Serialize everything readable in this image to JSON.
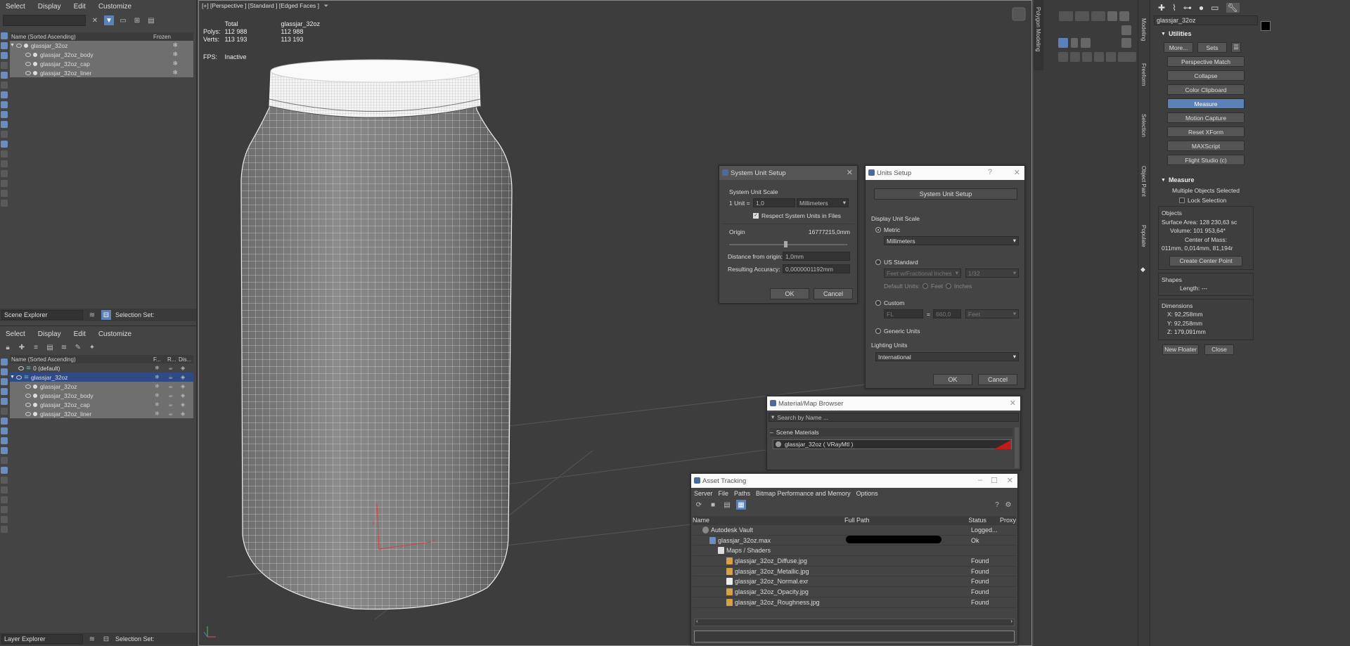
{
  "scene_explorer": {
    "menu": [
      "Select",
      "Display",
      "Edit",
      "Customize"
    ],
    "header_name": "Name (Sorted Ascending)",
    "header_frozen": "Frozen",
    "items": [
      "glassjar_32oz",
      "glassjar_32oz_body",
      "glassjar_32oz_cap",
      "glassjar_32oz_liner"
    ],
    "bottom_label": "Scene Explorer",
    "selection_set": "Selection Set:"
  },
  "layer_explorer": {
    "menu": [
      "Select",
      "Display",
      "Edit",
      "Customize"
    ],
    "header_name": "Name (Sorted Ascending)",
    "header_cols": [
      "F...",
      "R...",
      "Dis..."
    ],
    "items": [
      "0 (default)",
      "glassjar_32oz",
      "glassjar_32oz",
      "glassjar_32oz_body",
      "glassjar_32oz_cap",
      "glassjar_32oz_liner"
    ],
    "bottom_label": "Layer Explorer",
    "selection_set": "Selection Set:"
  },
  "viewport": {
    "label": "[+] [Perspective ] [Standard ] [Edged Faces ]",
    "stats": {
      "col_total": "Total",
      "col_object": "glassjar_32oz",
      "polys_label": "Polys:",
      "polys_total": "112 988",
      "polys_obj": "112 988",
      "verts_label": "Verts:",
      "verts_total": "113 193",
      "verts_obj": "113 193",
      "fps_label": "FPS:",
      "fps_value": "Inactive"
    }
  },
  "system_unit_setup": {
    "title": "System Unit Setup",
    "group": "System Unit Scale",
    "unit_label": "1 Unit =",
    "unit_value": "1,0",
    "unit_type": "Millimeters",
    "respect_label": "Respect System Units in Files",
    "origin_label": "Origin",
    "origin_value": "16777215,0mm",
    "distance_label": "Distance from origin:",
    "distance_value": "1,0mm",
    "accuracy_label": "Resulting Accuracy:",
    "accuracy_value": "0,0000001192mm",
    "ok": "OK",
    "cancel": "Cancel"
  },
  "units_setup": {
    "title": "Units Setup",
    "help": "?",
    "system_button": "System Unit Setup",
    "display_scale": "Display Unit Scale",
    "metric": "Metric",
    "metric_value": "Millimeters",
    "us_standard": "US Standard",
    "us_value": "Feet w/Fractional Inches",
    "us_fraction": "1/32",
    "default_units": "Default Units:",
    "feet": "Feet",
    "inches": "Inches",
    "custom": "Custom",
    "custom_value": "FL",
    "custom_equals": "=",
    "custom_amount": "660,0",
    "custom_unit": "Feet",
    "generic": "Generic Units",
    "lighting": "Lighting Units",
    "lighting_value": "International",
    "ok": "OK",
    "cancel": "Cancel"
  },
  "material_browser": {
    "title": "Material/Map Browser",
    "search": "Search by Name ...",
    "section": "Scene Materials",
    "item": "glassjar_32oz  ( VRayMtl )"
  },
  "asset_tracking": {
    "title": "Asset Tracking",
    "menu": [
      "Server",
      "File",
      "Paths",
      "Bitmap Performance and Memory",
      "Options"
    ],
    "columns": [
      "Name",
      "Full Path",
      "Status",
      "Proxy"
    ],
    "rows": [
      {
        "name": "Autodesk Vault",
        "status": "Logged..."
      },
      {
        "name": "glassjar_32oz.max",
        "status": "Ok"
      },
      {
        "name": "Maps / Shaders",
        "status": ""
      },
      {
        "name": "glassjar_32oz_Diffuse.jpg",
        "status": "Found"
      },
      {
        "name": "glassjar_32oz_Metallic.jpg",
        "status": "Found"
      },
      {
        "name": "glassjar_32oz_Normal.exr",
        "status": "Found"
      },
      {
        "name": "glassjar_32oz_Opacity.jpg",
        "status": "Found"
      },
      {
        "name": "glassjar_32oz_Roughness.jpg",
        "status": "Found"
      }
    ]
  },
  "ribbon": {
    "title": "Polygon Modeling",
    "tabs": [
      "Modeling",
      "Freeform",
      "Selection",
      "Object Paint",
      "Populate"
    ]
  },
  "command_panel": {
    "object_name": "glassjar_32oz",
    "utilities_title": "Utilities",
    "more": "More...",
    "sets": "Sets",
    "buttons": [
      "Perspective Match",
      "Collapse",
      "Color Clipboard",
      "Measure",
      "Motion Capture",
      "Reset XForm",
      "MAXScript",
      "Flight Studio (c)"
    ],
    "measure_title": "Measure",
    "multiple": "Multiple Objects Selected",
    "lock_selection": "Lock Selection",
    "objects_group": "Objects",
    "surface_area": "Surface Area:  128 230,63 sc",
    "volume": "Volume:  101 953,64*",
    "center_mass": "Center of Mass:",
    "center_mass_value": "011mm, 0,014mm, 81,194r",
    "create_center": "Create Center Point",
    "shapes_group": "Shapes",
    "length": "Length:  ---",
    "dimensions_group": "Dimensions",
    "dim_x": "X:   92,258mm",
    "dim_y": "Y:   92,258mm",
    "dim_z": "Z:   179,091mm",
    "new_floater": "New Floater",
    "close": "Close"
  }
}
